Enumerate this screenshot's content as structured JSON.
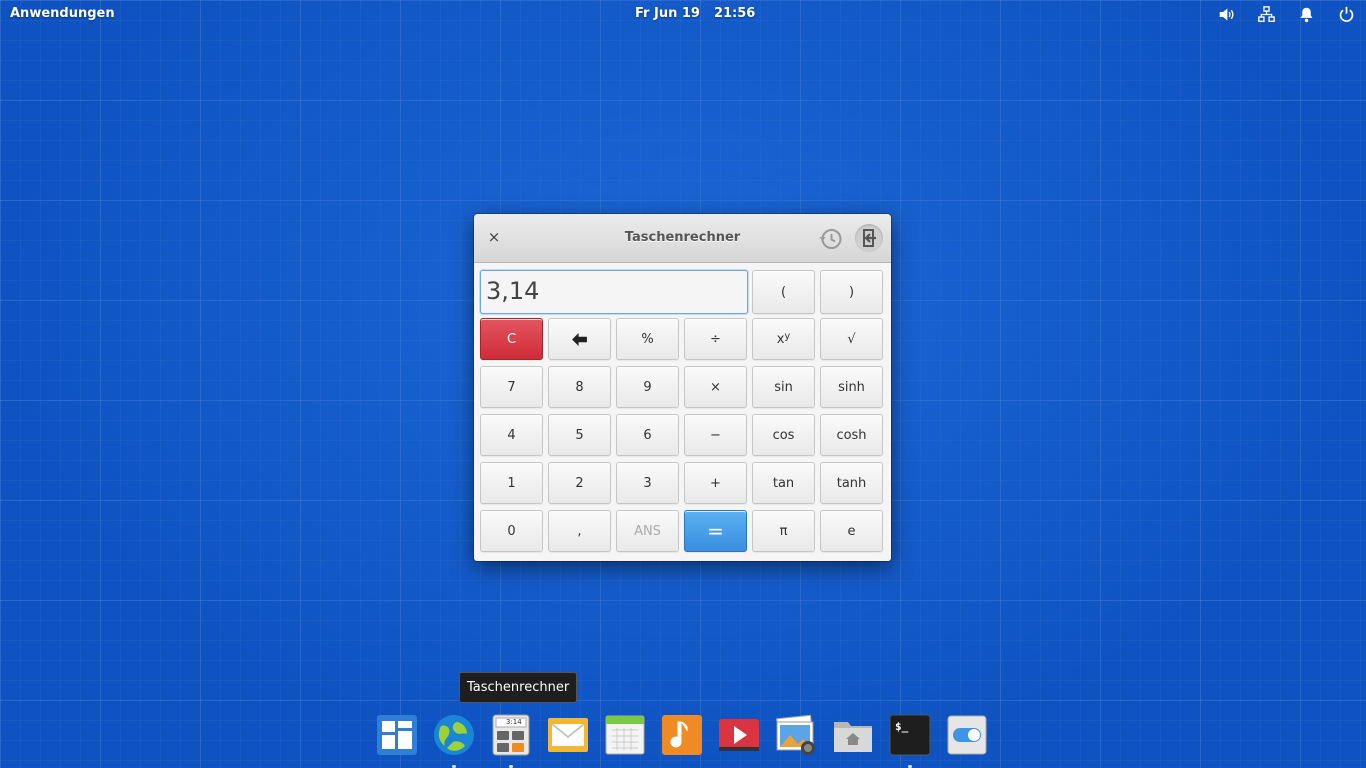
{
  "panel": {
    "applications_label": "Anwendungen",
    "date": "Fr Jun 19",
    "time": "21:56",
    "tray_icons": [
      "volume-icon",
      "network-icon",
      "notification-bell-icon",
      "power-icon"
    ]
  },
  "window": {
    "title": "Taschenrechner",
    "close_symbol": "×",
    "display_value": "3,14",
    "buttons": {
      "open_paren": "(",
      "close_paren": ")",
      "clear": "C",
      "percent": "%",
      "divide": "÷",
      "power_base": "x",
      "power_exp": "y",
      "sqrt": "√",
      "seven": "7",
      "eight": "8",
      "nine": "9",
      "multiply": "×",
      "sin": "sin",
      "sinh": "sinh",
      "four": "4",
      "five": "5",
      "six": "6",
      "minus": "−",
      "cos": "cos",
      "cosh": "cosh",
      "one": "1",
      "two": "2",
      "three": "3",
      "plus": "+",
      "tan": "tan",
      "tanh": "tanh",
      "zero": "0",
      "comma": ",",
      "ans": "ANS",
      "equals": "=",
      "pi": "π",
      "e": "e"
    },
    "colors": {
      "clear": "#d9343f",
      "equals": "#3e95e4",
      "display_border": "#6aa8e6"
    }
  },
  "tooltip": {
    "text": "Taschenrechner"
  },
  "dock": {
    "items": [
      "multitasking-view-icon",
      "web-browser-icon",
      "calculator-icon",
      "mail-icon",
      "calendar-icon",
      "music-icon",
      "videos-icon",
      "photos-icon",
      "files-icon",
      "terminal-icon",
      "system-settings-icon"
    ],
    "calculator_icon_text": "3:14",
    "terminal_icon_text": "$_"
  }
}
